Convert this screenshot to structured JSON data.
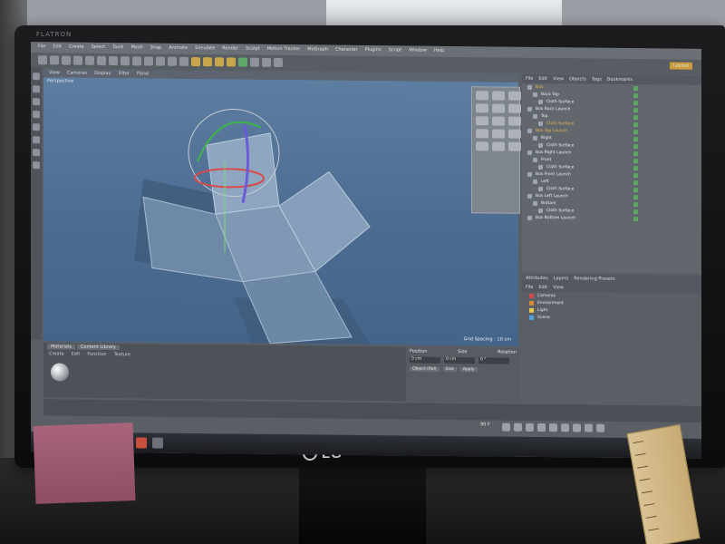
{
  "monitor": {
    "brand_top": "FLATRON",
    "brand_bottom": "LG"
  },
  "app": {
    "menu": [
      "File",
      "Edit",
      "Create",
      "Select",
      "Tools",
      "Mesh",
      "Snap",
      "Animate",
      "Simulate",
      "Render",
      "Sculpt",
      "Motion Tracker",
      "MoGraph",
      "Character",
      "Plugins",
      "Script",
      "Window",
      "Help"
    ],
    "layout_label": "Layout"
  },
  "viewport": {
    "header": [
      "View",
      "Cameras",
      "Display",
      "Filter",
      "Panel"
    ],
    "label": "Perspective",
    "grid_spacing": "Grid Spacing : 10 cm"
  },
  "object_panel": {
    "tabs": [
      "File",
      "Edit",
      "View",
      "Objects",
      "Tags",
      "Bookmarks"
    ],
    "rows": [
      {
        "name": "Box",
        "selected": true
      },
      {
        "name": "Back Top",
        "selected": false
      },
      {
        "name": "Cloth Surface",
        "selected": false
      },
      {
        "name": "Box Back Launch",
        "selected": false
      },
      {
        "name": "Top",
        "selected": false
      },
      {
        "name": "Cloth Surface",
        "selected": true
      },
      {
        "name": "Box Top Launch",
        "selected": true
      },
      {
        "name": "Right",
        "selected": false
      },
      {
        "name": "Cloth Surface",
        "selected": false
      },
      {
        "name": "Box Right Launch",
        "selected": false
      },
      {
        "name": "Front",
        "selected": false
      },
      {
        "name": "Cloth Surface",
        "selected": false
      },
      {
        "name": "Box Front Launch",
        "selected": false
      },
      {
        "name": "Left",
        "selected": false
      },
      {
        "name": "Cloth Surface",
        "selected": false
      },
      {
        "name": "Box Left Launch",
        "selected": false
      },
      {
        "name": "Bottom",
        "selected": false
      },
      {
        "name": "Cloth Surface",
        "selected": false
      },
      {
        "name": "Box Bottom Launch",
        "selected": false
      }
    ]
  },
  "layer_panel": {
    "tabs": [
      "Attributes",
      "Layers",
      "Rendering Presets"
    ],
    "menu": [
      "File",
      "Edit",
      "View"
    ],
    "rows": [
      {
        "name": "Cameras",
        "color": "#d24b4b"
      },
      {
        "name": "Environment",
        "color": "#d28b34"
      },
      {
        "name": "Light",
        "color": "#e0c64a"
      },
      {
        "name": "Scene",
        "color": "#4ea0d9"
      }
    ]
  },
  "material_panel": {
    "tabs": [
      "Materials",
      "Content Library"
    ],
    "menu": [
      "Create",
      "Edit",
      "Function",
      "Texture"
    ]
  },
  "coordinates": {
    "headers": [
      "Position",
      "Size",
      "Rotation"
    ],
    "values": [
      "0 cm",
      "0 cm",
      "0 °"
    ],
    "object_mode": "Object (Rel)",
    "size_mode": "Size",
    "apply": "Apply"
  },
  "timeline": {
    "frame": "90 F"
  }
}
